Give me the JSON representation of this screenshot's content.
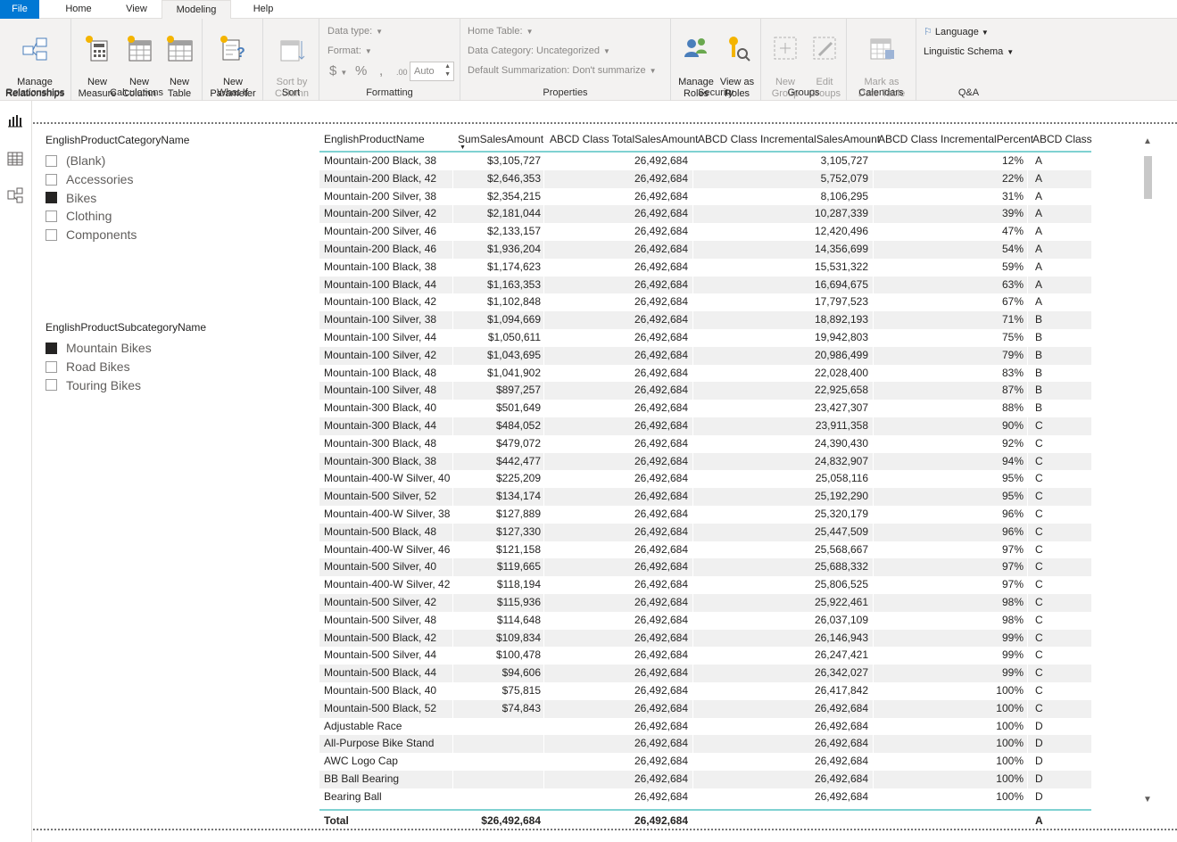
{
  "tabs": {
    "file": "File",
    "home": "Home",
    "view": "View",
    "modeling": "Modeling",
    "help": "Help"
  },
  "ribbon": {
    "relationships": {
      "button": "Manage\nRelationships",
      "label": "Relationships"
    },
    "calculations": {
      "new_measure": "New\nMeasure",
      "new_column": "New\nColumn",
      "new_table": "New\nTable",
      "label": "Calculations"
    },
    "whatif": {
      "new_parameter": "New\nParameter",
      "label": "What If"
    },
    "sort": {
      "sort_by_column": "Sort by\nColumn",
      "label": "Sort"
    },
    "formatting": {
      "data_type": "Data type:",
      "format": "Format:",
      "currency": "$",
      "percent": "%",
      "comma": ",",
      "decimals": ".00",
      "auto": "Auto",
      "label": "Formatting"
    },
    "properties": {
      "home_table": "Home Table:",
      "data_category": "Data Category: Uncategorized",
      "default_summarization": "Default Summarization: Don't summarize",
      "label": "Properties"
    },
    "security": {
      "manage_roles": "Manage\nRoles",
      "view_as_roles": "View as\nRoles",
      "label": "Security"
    },
    "groups": {
      "new_group": "New\nGroup",
      "edit_groups": "Edit\nGroups",
      "label": "Groups"
    },
    "calendars": {
      "mark_as_date_table": "Mark as\nDate Table",
      "label": "Calendars"
    },
    "qa": {
      "language": "Language",
      "linguistic_schema": "Linguistic Schema",
      "label": "Q&A"
    }
  },
  "slicer_category": {
    "title": "EnglishProductCategoryName",
    "items": [
      {
        "label": "(Blank)",
        "checked": false
      },
      {
        "label": "Accessories",
        "checked": false
      },
      {
        "label": "Bikes",
        "checked": true
      },
      {
        "label": "Clothing",
        "checked": false
      },
      {
        "label": "Components",
        "checked": false
      }
    ]
  },
  "slicer_subcategory": {
    "title": "EnglishProductSubcategoryName",
    "items": [
      {
        "label": "Mountain Bikes",
        "checked": true
      },
      {
        "label": "Road Bikes",
        "checked": false
      },
      {
        "label": "Touring Bikes",
        "checked": false
      }
    ]
  },
  "table": {
    "columns": [
      "EnglishProductName",
      "SumSalesAmount",
      "ABCD Class TotalSalesAmount",
      "ABCD Class IncrementalSalesAmount",
      "ABCD Class IncrementalPercent",
      "ABCD Class"
    ],
    "rows": [
      [
        "Mountain-200 Black, 38",
        "$3,105,727",
        "26,492,684",
        "3,105,727",
        "12%",
        "A"
      ],
      [
        "Mountain-200 Black, 42",
        "$2,646,353",
        "26,492,684",
        "5,752,079",
        "22%",
        "A"
      ],
      [
        "Mountain-200 Silver, 38",
        "$2,354,215",
        "26,492,684",
        "8,106,295",
        "31%",
        "A"
      ],
      [
        "Mountain-200 Silver, 42",
        "$2,181,044",
        "26,492,684",
        "10,287,339",
        "39%",
        "A"
      ],
      [
        "Mountain-200 Silver, 46",
        "$2,133,157",
        "26,492,684",
        "12,420,496",
        "47%",
        "A"
      ],
      [
        "Mountain-200 Black, 46",
        "$1,936,204",
        "26,492,684",
        "14,356,699",
        "54%",
        "A"
      ],
      [
        "Mountain-100 Black, 38",
        "$1,174,623",
        "26,492,684",
        "15,531,322",
        "59%",
        "A"
      ],
      [
        "Mountain-100 Black, 44",
        "$1,163,353",
        "26,492,684",
        "16,694,675",
        "63%",
        "A"
      ],
      [
        "Mountain-100 Black, 42",
        "$1,102,848",
        "26,492,684",
        "17,797,523",
        "67%",
        "A"
      ],
      [
        "Mountain-100 Silver, 38",
        "$1,094,669",
        "26,492,684",
        "18,892,193",
        "71%",
        "B"
      ],
      [
        "Mountain-100 Silver, 44",
        "$1,050,611",
        "26,492,684",
        "19,942,803",
        "75%",
        "B"
      ],
      [
        "Mountain-100 Silver, 42",
        "$1,043,695",
        "26,492,684",
        "20,986,499",
        "79%",
        "B"
      ],
      [
        "Mountain-100 Black, 48",
        "$1,041,902",
        "26,492,684",
        "22,028,400",
        "83%",
        "B"
      ],
      [
        "Mountain-100 Silver, 48",
        "$897,257",
        "26,492,684",
        "22,925,658",
        "87%",
        "B"
      ],
      [
        "Mountain-300 Black, 40",
        "$501,649",
        "26,492,684",
        "23,427,307",
        "88%",
        "B"
      ],
      [
        "Mountain-300 Black, 44",
        "$484,052",
        "26,492,684",
        "23,911,358",
        "90%",
        "C"
      ],
      [
        "Mountain-300 Black, 48",
        "$479,072",
        "26,492,684",
        "24,390,430",
        "92%",
        "C"
      ],
      [
        "Mountain-300 Black, 38",
        "$442,477",
        "26,492,684",
        "24,832,907",
        "94%",
        "C"
      ],
      [
        "Mountain-400-W Silver, 40",
        "$225,209",
        "26,492,684",
        "25,058,116",
        "95%",
        "C"
      ],
      [
        "Mountain-500 Silver, 52",
        "$134,174",
        "26,492,684",
        "25,192,290",
        "95%",
        "C"
      ],
      [
        "Mountain-400-W Silver, 38",
        "$127,889",
        "26,492,684",
        "25,320,179",
        "96%",
        "C"
      ],
      [
        "Mountain-500 Black, 48",
        "$127,330",
        "26,492,684",
        "25,447,509",
        "96%",
        "C"
      ],
      [
        "Mountain-400-W Silver, 46",
        "$121,158",
        "26,492,684",
        "25,568,667",
        "97%",
        "C"
      ],
      [
        "Mountain-500 Silver, 40",
        "$119,665",
        "26,492,684",
        "25,688,332",
        "97%",
        "C"
      ],
      [
        "Mountain-400-W Silver, 42",
        "$118,194",
        "26,492,684",
        "25,806,525",
        "97%",
        "C"
      ],
      [
        "Mountain-500 Silver, 42",
        "$115,936",
        "26,492,684",
        "25,922,461",
        "98%",
        "C"
      ],
      [
        "Mountain-500 Silver, 48",
        "$114,648",
        "26,492,684",
        "26,037,109",
        "98%",
        "C"
      ],
      [
        "Mountain-500 Black, 42",
        "$109,834",
        "26,492,684",
        "26,146,943",
        "99%",
        "C"
      ],
      [
        "Mountain-500 Silver, 44",
        "$100,478",
        "26,492,684",
        "26,247,421",
        "99%",
        "C"
      ],
      [
        "Mountain-500 Black, 44",
        "$94,606",
        "26,492,684",
        "26,342,027",
        "99%",
        "C"
      ],
      [
        "Mountain-500 Black, 40",
        "$75,815",
        "26,492,684",
        "26,417,842",
        "100%",
        "C"
      ],
      [
        "Mountain-500 Black, 52",
        "$74,843",
        "26,492,684",
        "26,492,684",
        "100%",
        "C"
      ],
      [
        "Adjustable Race",
        "",
        "26,492,684",
        "26,492,684",
        "100%",
        "D"
      ],
      [
        "All-Purpose Bike Stand",
        "",
        "26,492,684",
        "26,492,684",
        "100%",
        "D"
      ],
      [
        "AWC Logo Cap",
        "",
        "26,492,684",
        "26,492,684",
        "100%",
        "D"
      ],
      [
        "BB Ball Bearing",
        "",
        "26,492,684",
        "26,492,684",
        "100%",
        "D"
      ],
      [
        "Bearing Ball",
        "",
        "26,492,684",
        "26,492,684",
        "100%",
        "D"
      ]
    ],
    "total": [
      "Total",
      "$26,492,684",
      "26,492,684",
      "",
      "",
      "A"
    ]
  },
  "colors": {
    "accent": "#0078d4",
    "table_rule": "#7fd1d1"
  }
}
